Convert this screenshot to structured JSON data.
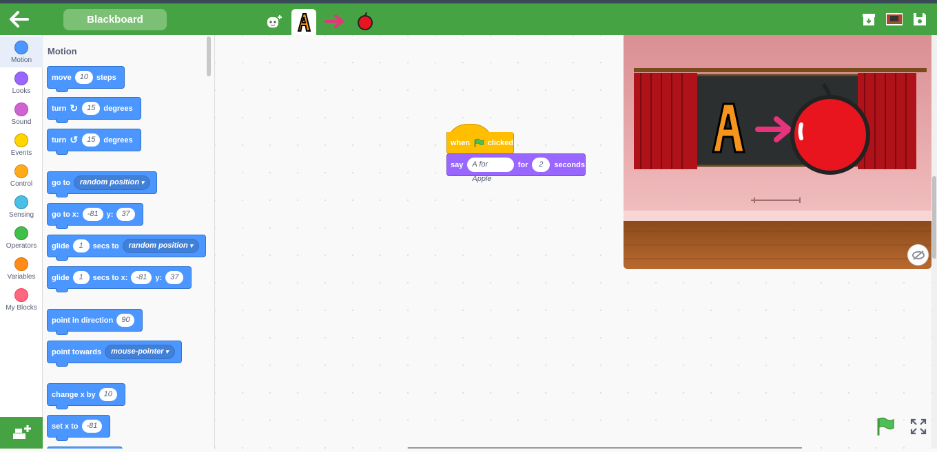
{
  "topbar": {
    "project_title": "Blackboard",
    "sprite_tabs": [
      "add-sprite",
      "letter-A",
      "arrow",
      "apple"
    ]
  },
  "categories": [
    {
      "label": "Motion",
      "color": "#4c97ff"
    },
    {
      "label": "Looks",
      "color": "#9966ff"
    },
    {
      "label": "Sound",
      "color": "#cf63cf"
    },
    {
      "label": "Events",
      "color": "#ffd500"
    },
    {
      "label": "Control",
      "color": "#ffab19"
    },
    {
      "label": "Sensing",
      "color": "#4cbfe6"
    },
    {
      "label": "Operators",
      "color": "#40bf4a"
    },
    {
      "label": "Variables",
      "color": "#ff8c1a"
    },
    {
      "label": "My Blocks",
      "color": "#ff6680"
    }
  ],
  "palette": {
    "title": "Motion",
    "move": {
      "a": "move",
      "v": "10",
      "b": "steps"
    },
    "turn_right": {
      "a": "turn",
      "v": "15",
      "b": "degrees"
    },
    "turn_left": {
      "a": "turn",
      "v": "15",
      "b": "degrees"
    },
    "goto": {
      "a": "go to",
      "dd": "random position"
    },
    "gotoxy": {
      "a": "go to x:",
      "x": "-81",
      "yl": "y:",
      "y": "37"
    },
    "glide": {
      "a": "glide",
      "v": "1",
      "b": "secs to",
      "dd": "random position"
    },
    "glidexy": {
      "a": "glide",
      "v": "1",
      "b": "secs to x:",
      "x": "-81",
      "yl": "y:",
      "y": "37"
    },
    "point_dir": {
      "a": "point in direction",
      "v": "90"
    },
    "point_towards": {
      "a": "point towards",
      "dd": "mouse-pointer"
    },
    "change_x": {
      "a": "change x by",
      "v": "10"
    },
    "set_x": {
      "a": "set x to",
      "v": "-81"
    }
  },
  "script": {
    "hat_when": "when",
    "hat_clicked": "clicked",
    "say": "say",
    "say_text": "A for Apple",
    "for": "for",
    "secs": "2",
    "seconds": "seconds"
  }
}
